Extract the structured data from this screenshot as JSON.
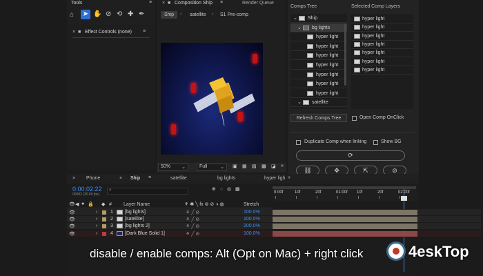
{
  "tools_panel": {
    "title": "Tools",
    "tool_icons": [
      "home-icon",
      "selection-arrow-icon",
      "hand-icon",
      "rotate-icon",
      "anchor-icon",
      "pen-icon",
      "text-icon"
    ]
  },
  "effect_controls": {
    "title": "Effect Controls (none)"
  },
  "composition": {
    "tab": "Composition Ship",
    "render_queue": "Render Queue",
    "breadcrumbs": [
      "Ship",
      "satellite",
      "S1 Pre-comp"
    ],
    "zoom": "50%",
    "resolution": "Full"
  },
  "comps_tree": {
    "title": "Comps Tree",
    "items": [
      {
        "label": "Ship",
        "level": 0,
        "expanded": true
      },
      {
        "label": "bg lights",
        "level": 1,
        "expanded": true
      },
      {
        "label": "hyper light",
        "level": 2
      },
      {
        "label": "hyper light",
        "level": 2
      },
      {
        "label": "hyper light",
        "level": 2
      },
      {
        "label": "hyper light",
        "level": 2
      },
      {
        "label": "hyper light",
        "level": 2
      },
      {
        "label": "hyper light",
        "level": 2
      },
      {
        "label": "hyper light",
        "level": 2
      },
      {
        "label": "satellite",
        "level": 1,
        "expanded": true
      }
    ]
  },
  "selected_layers": {
    "title": "Selected Comp Layers",
    "items": [
      "hyper light",
      "hyper light",
      "hyper light",
      "hyper light",
      "hyper light",
      "hyper light",
      "hyper light"
    ]
  },
  "controls": {
    "refresh_button": "Refresh Comps Tree",
    "open_comp_label": "Open Comp OnClick",
    "duplicate_label": "Duplicate Comp when linking",
    "show_bg_label": "Show BG"
  },
  "timeline": {
    "tabs": [
      "Phone",
      "Ship",
      "satellite",
      "bg lights",
      "hyper ligh"
    ],
    "active_tab": "Ship",
    "timecode": "0:00:02:22",
    "frame_info": "00082 (30.00 fps)",
    "search_placeholder": "",
    "col_layer_name": "Layer Name",
    "col_stretch": "Stretch",
    "ruler": [
      "0:00f",
      "10f",
      "20f",
      "01:00f",
      "10f",
      "20f",
      "02:00f"
    ],
    "layers": [
      {
        "num": "1",
        "name": "[bg lights]",
        "stretch": "100.0%",
        "label_color": "#b89a66"
      },
      {
        "num": "2",
        "name": "[satellite]",
        "stretch": "100.0%",
        "label_color": "#b89a66"
      },
      {
        "num": "3",
        "name": "[bg lights 2]",
        "stretch": "200.0%",
        "label_color": "#b89a66"
      },
      {
        "num": "4",
        "name": "[Dark Blue Solid 1]",
        "stretch": "100.0%",
        "label_color": "#c03a3a"
      }
    ]
  },
  "caption": "disable / enable comps: Alt (Opt on Mac) + right click",
  "watermark": {
    "text": "4eskTop"
  },
  "colors": {
    "accent": "#3f8ef0",
    "caption": "#ffffff",
    "gold": "#e0a21f"
  }
}
